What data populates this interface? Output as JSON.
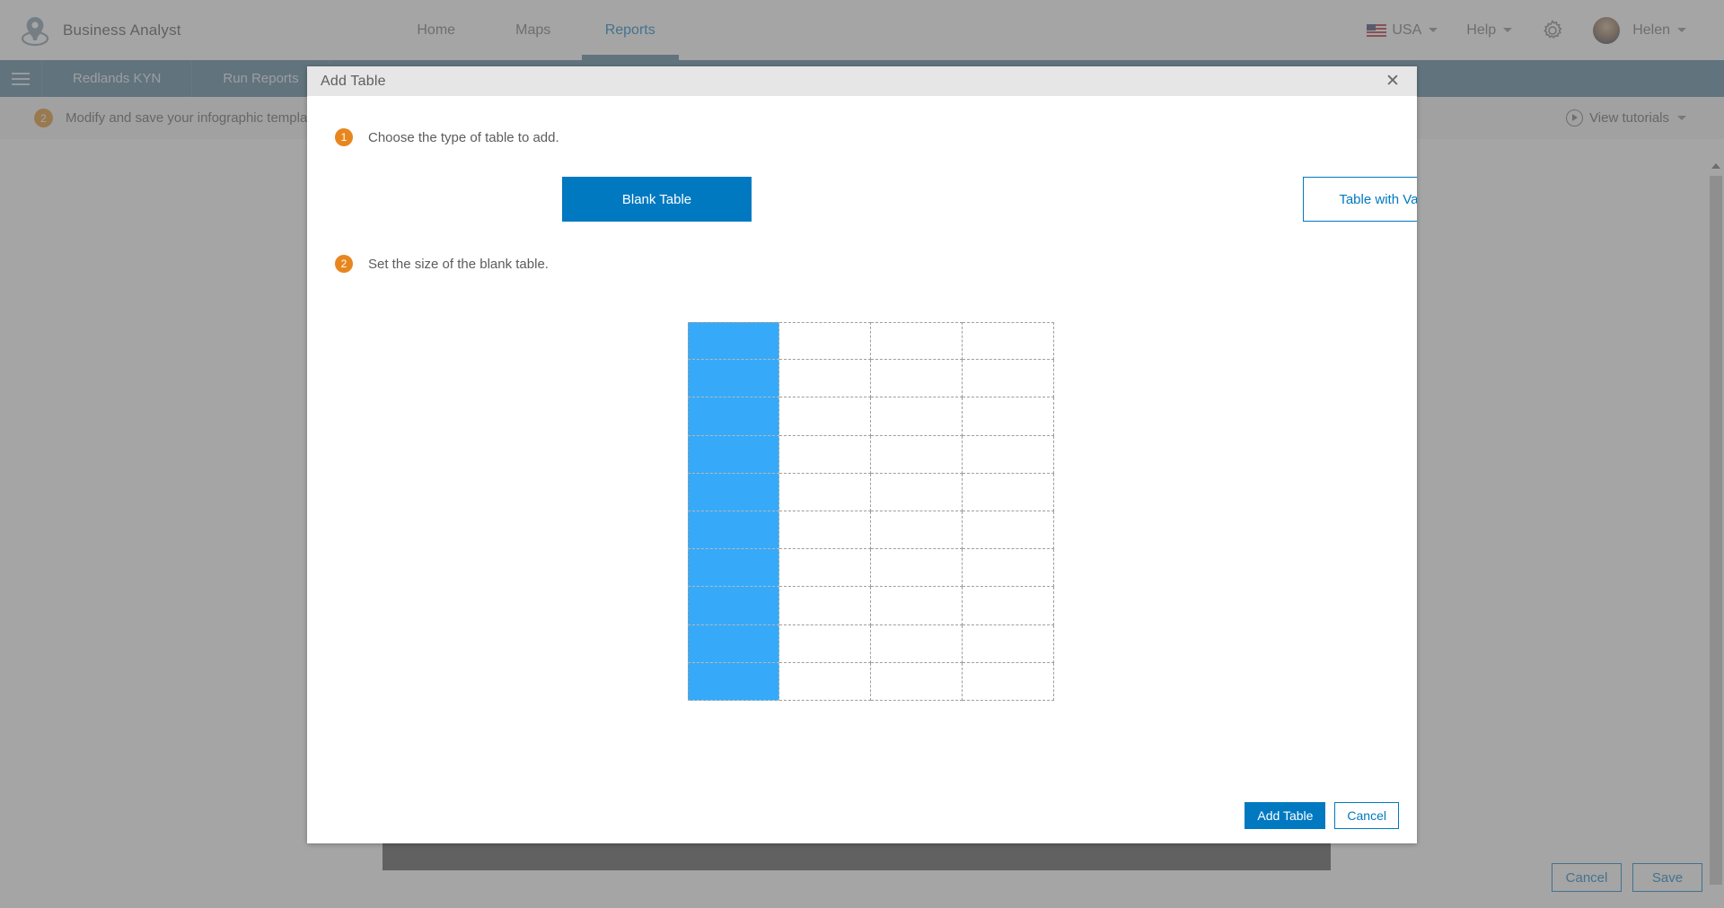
{
  "header": {
    "brand": "Business Analyst",
    "logo_icon": "location-pin-icon",
    "nav": [
      {
        "label": "Home",
        "active": false
      },
      {
        "label": "Maps",
        "active": false
      },
      {
        "label": "Reports",
        "active": true
      }
    ],
    "right": {
      "country": "USA",
      "country_flag_icon": "usa-flag-icon",
      "help": "Help",
      "settings_icon": "gear-icon",
      "user": "Helen",
      "avatar_icon": "user-avatar"
    }
  },
  "toolbar": {
    "menu_icon": "hamburger-menu-icon",
    "items": [
      {
        "label": "Redlands KYN"
      },
      {
        "label": "Run Reports"
      }
    ]
  },
  "step_bar": {
    "badge": "2",
    "text": "Modify and save your infographic template.",
    "tutorials_label": "View tutorials",
    "tutorials_icon": "play-circle-icon",
    "caret_icon": "chevron-down-icon"
  },
  "page_actions": {
    "cancel_label": "Cancel",
    "save_label": "Save"
  },
  "modal": {
    "title": "Add Table",
    "close_icon": "close-icon",
    "step1": {
      "number": "1",
      "text": "Choose the type of table to add."
    },
    "type_buttons": {
      "blank_table": "Blank Table",
      "table_with_variables": "Table with Variables",
      "selected": "Blank Table"
    },
    "step2": {
      "number": "2",
      "text": "Set the size of the blank table."
    },
    "size_grid": {
      "columns": 4,
      "rows": 10,
      "selected_columns": 1,
      "selected_rows": 10,
      "selected_color": "#36aaf8",
      "cell_border_style": "dashed"
    },
    "footer": {
      "add_label": "Add Table",
      "cancel_label": "Cancel"
    }
  },
  "colors": {
    "accent_blue": "#0079c1",
    "toolbar_blue": "#4c7c96",
    "step_orange": "#e8861e",
    "grid_selection": "#36aaf8"
  }
}
